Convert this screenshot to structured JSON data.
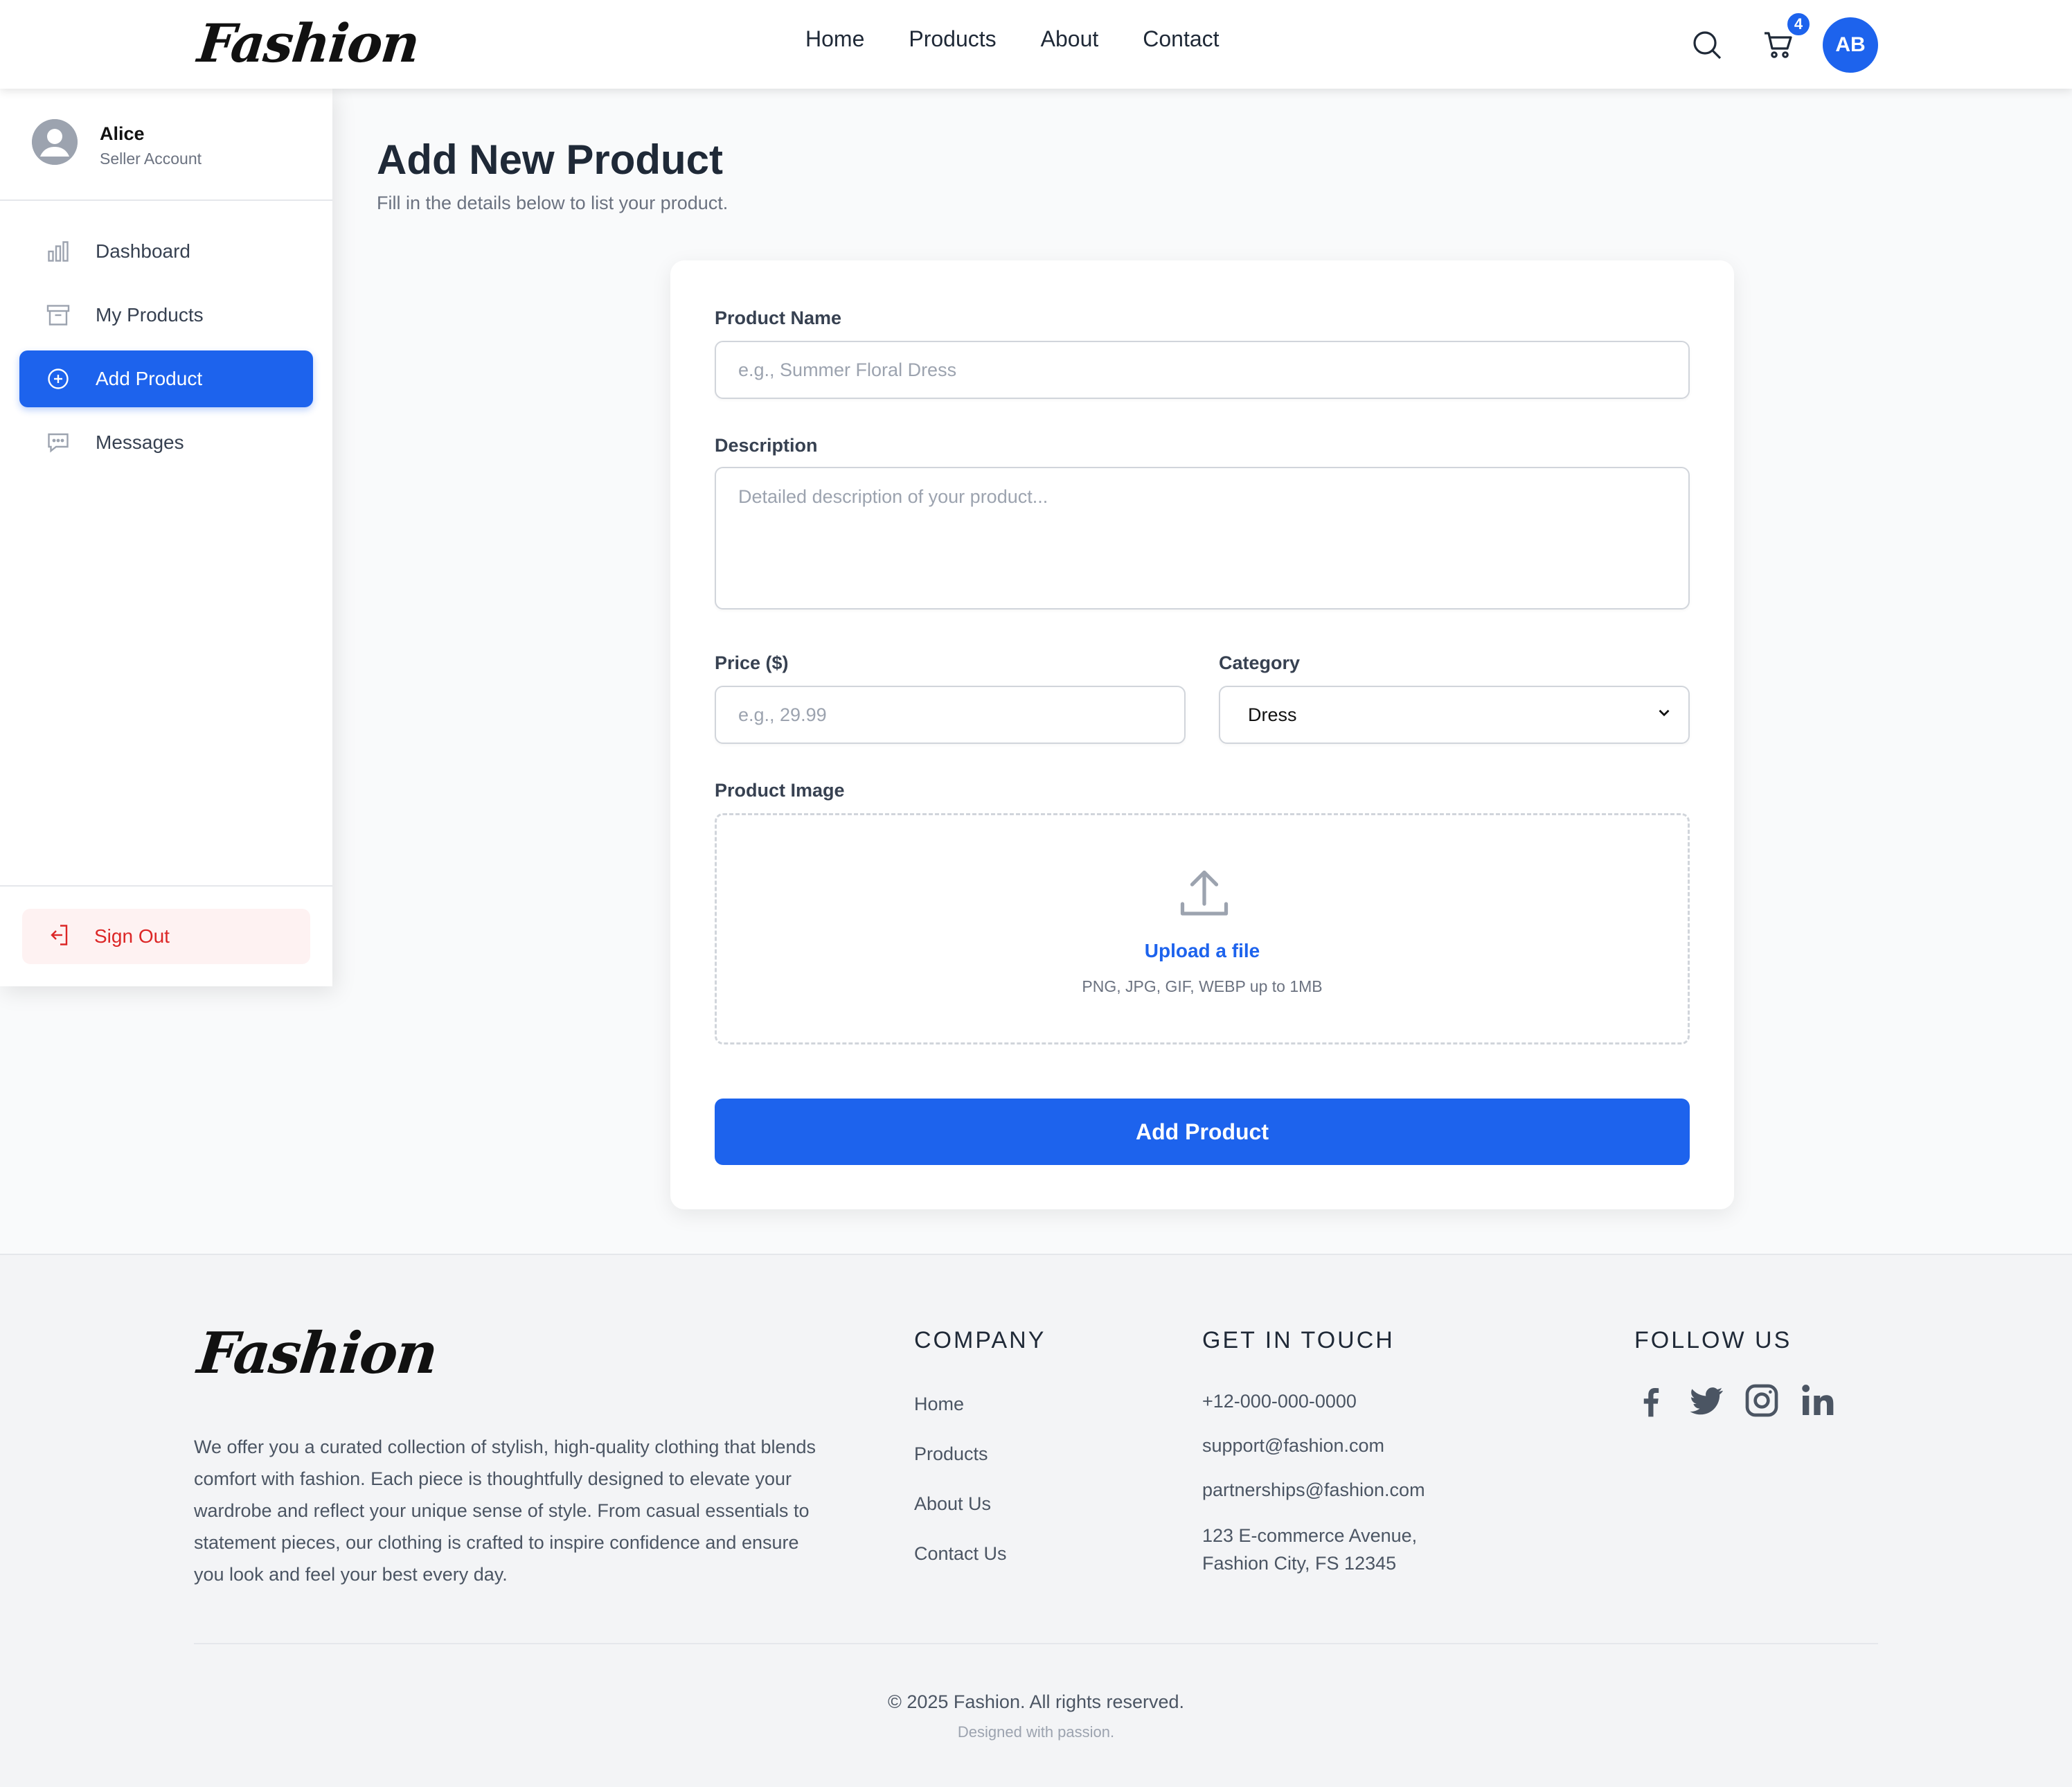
{
  "brand": {
    "name": "Fashion"
  },
  "header": {
    "nav": [
      "Home",
      "Products",
      "About",
      "Contact"
    ],
    "cart_count": "4",
    "avatar_initials": "AB",
    "icons": {
      "search": "search-icon",
      "cart": "cart-icon"
    }
  },
  "sidebar": {
    "user_name": "Alice",
    "user_role": "Seller Account",
    "items": [
      {
        "label": "Dashboard",
        "icon": "bar-chart-icon",
        "active": false
      },
      {
        "label": "My Products",
        "icon": "archive-box-icon",
        "active": false
      },
      {
        "label": "Add Product",
        "icon": "plus-circle-icon",
        "active": true
      },
      {
        "label": "Messages",
        "icon": "chat-bubble-icon",
        "active": false
      }
    ],
    "sign_out": "Sign Out"
  },
  "main": {
    "title": "Add New Product",
    "subtitle": "Fill in the details below to list your product."
  },
  "form": {
    "name_label": "Product Name",
    "name_placeholder": "e.g., Summer Floral Dress",
    "desc_label": "Description",
    "desc_placeholder": "Detailed description of your product...",
    "price_label": "Price ($)",
    "price_placeholder": "e.g., 29.99",
    "category_label": "Category",
    "category_value": "Dress",
    "image_label": "Product Image",
    "upload_link": "Upload a file",
    "upload_hint": "PNG, JPG, GIF, WEBP up to 1MB",
    "submit_label": "Add Product"
  },
  "footer": {
    "description": "We offer you a curated collection of stylish, high-quality clothing that blends comfort with fashion. Each piece is thoughtfully designed to elevate your wardrobe and reflect your unique sense of style. From casual essentials to statement pieces, our clothing is crafted to inspire confidence and ensure you look and feel your best every day.",
    "company_heading": "COMPANY",
    "company_links": [
      "Home",
      "Products",
      "About Us",
      "Contact Us"
    ],
    "contact_heading": "GET IN TOUCH",
    "phone": "+12-000-000-0000",
    "email_support": "support@fashion.com",
    "email_partners": "partnerships@fashion.com",
    "address_line1": "123 E-commerce Avenue,",
    "address_line2": "Fashion City, FS 12345",
    "follow_heading": "FOLLOW US",
    "social_icons": [
      "facebook-icon",
      "twitter-icon",
      "instagram-icon",
      "linkedin-icon"
    ],
    "copyright": "© 2025 Fashion. All rights reserved.",
    "tagline": "Designed with passion."
  },
  "colors": {
    "accent": "#1d63ed",
    "danger": "#dc2626",
    "page_bg": "#f9fafb",
    "footer_bg": "#f3f4f6"
  }
}
